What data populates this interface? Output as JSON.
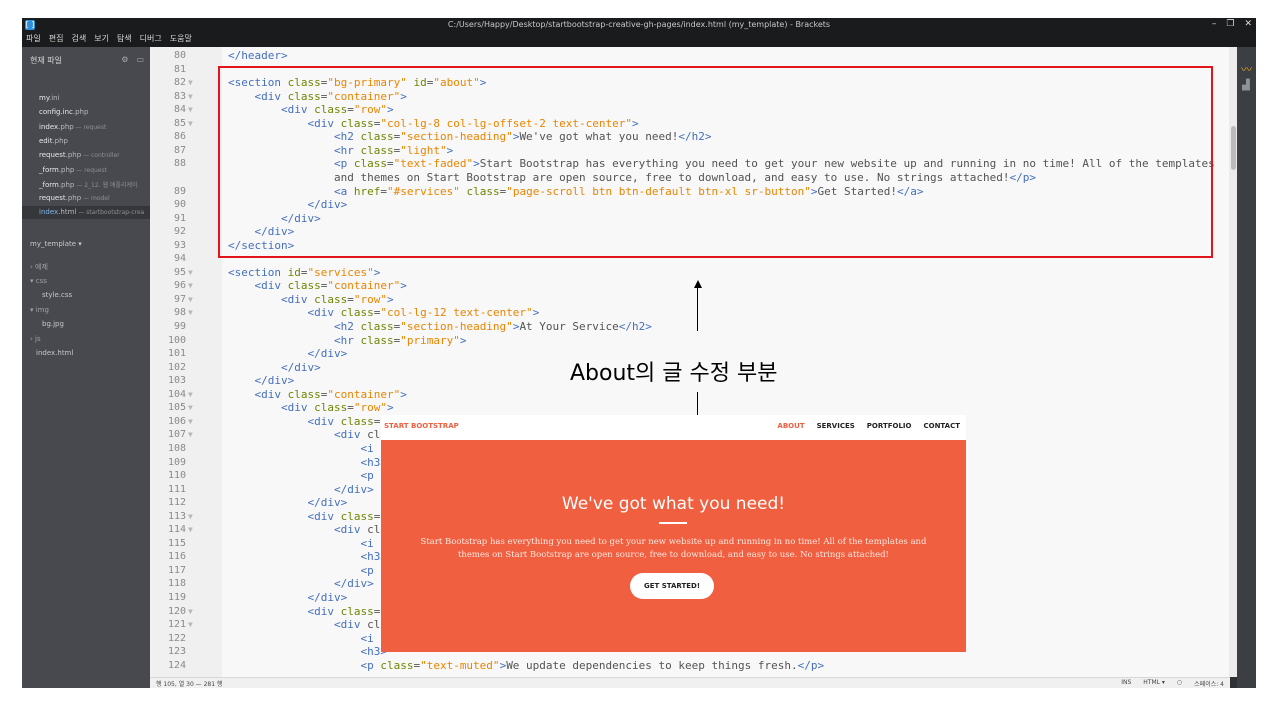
{
  "window": {
    "title": "C:/Users/Happy/Desktop/startbootstrap-creative-gh-pages/index.html (my_template) - Brackets",
    "controls": [
      "–",
      "❐",
      "✕"
    ]
  },
  "menu": [
    "파일",
    "편집",
    "검색",
    "보기",
    "탐색",
    "디버그",
    "도움말"
  ],
  "sidebar": {
    "header": "현재 파일",
    "working_files": [
      {
        "name": "my",
        "ext": ".ini",
        "sub": ""
      },
      {
        "name": "config.inc",
        "ext": ".php",
        "sub": ""
      },
      {
        "name": "index",
        "ext": ".php",
        "sub": " — request"
      },
      {
        "name": "edit",
        "ext": ".php",
        "sub": ""
      },
      {
        "name": "request",
        "ext": ".php",
        "sub": " — controller"
      },
      {
        "name": "_form",
        "ext": ".php",
        "sub": " — request"
      },
      {
        "name": "_form",
        "ext": ".php",
        "sub": " — 2_12. 웹 애플리케이"
      },
      {
        "name": "request",
        "ext": ".php",
        "sub": " — model"
      },
      {
        "name": "index",
        "ext": ".html",
        "sub": " — startbootstrap-crea"
      }
    ],
    "project": "my_template ▾",
    "tree": [
      {
        "label": "› 예제",
        "dim": true
      },
      {
        "label": "▾ css",
        "dim": true
      },
      {
        "label": "style.css",
        "dim": false
      },
      {
        "label": "▾ img",
        "dim": true
      },
      {
        "label": "bg.jpg",
        "dim": false
      },
      {
        "label": "› js",
        "dim": true
      },
      {
        "label": "index.html",
        "dim": false
      }
    ]
  },
  "code_lines": [
    {
      "n": "80",
      "fold": "",
      "code": "</header>"
    },
    {
      "n": "81",
      "fold": "",
      "code": ""
    },
    {
      "n": "82",
      "fold": "▼",
      "code": "<section class=\"bg-primary\" id=\"about\">"
    },
    {
      "n": "83",
      "fold": "▼",
      "code": "    <div class=\"container\">"
    },
    {
      "n": "84",
      "fold": "▼",
      "code": "        <div class=\"row\">"
    },
    {
      "n": "85",
      "fold": "▼",
      "code": "            <div class=\"col-lg-8 col-lg-offset-2 text-center\">"
    },
    {
      "n": "86",
      "fold": "",
      "code": "                <h2 class=\"section-heading\">We've got what you need!</h2>"
    },
    {
      "n": "87",
      "fold": "",
      "code": "                <hr class=\"light\">"
    },
    {
      "n": "88",
      "fold": "",
      "code": "                <p class=\"text-faded\">Start Bootstrap has everything you need to get your new website up and running in no time! All of the templates"
    },
    {
      "n": "",
      "fold": "",
      "code": "                and themes on Start Bootstrap are open source, free to download, and easy to use. No strings attached!</p>"
    },
    {
      "n": "89",
      "fold": "",
      "code": "                <a href=\"#services\" class=\"page-scroll btn btn-default btn-xl sr-button\">Get Started!</a>"
    },
    {
      "n": "90",
      "fold": "",
      "code": "            </div>"
    },
    {
      "n": "91",
      "fold": "",
      "code": "        </div>"
    },
    {
      "n": "92",
      "fold": "",
      "code": "    </div>"
    },
    {
      "n": "93",
      "fold": "",
      "code": "</section>"
    },
    {
      "n": "94",
      "fold": "",
      "code": ""
    },
    {
      "n": "95",
      "fold": "▼",
      "code": "<section id=\"services\">"
    },
    {
      "n": "96",
      "fold": "▼",
      "code": "    <div class=\"container\">"
    },
    {
      "n": "97",
      "fold": "▼",
      "code": "        <div class=\"row\">"
    },
    {
      "n": "98",
      "fold": "▼",
      "code": "            <div class=\"col-lg-12 text-center\">"
    },
    {
      "n": "99",
      "fold": "",
      "code": "                <h2 class=\"section-heading\">At Your Service</h2>"
    },
    {
      "n": "100",
      "fold": "",
      "code": "                <hr class=\"primary\">"
    },
    {
      "n": "101",
      "fold": "",
      "code": "            </div>"
    },
    {
      "n": "102",
      "fold": "",
      "code": "        </div>"
    },
    {
      "n": "103",
      "fold": "",
      "code": "    </div>"
    },
    {
      "n": "104",
      "fold": "▼",
      "code": "    <div class=\"container\">"
    },
    {
      "n": "105",
      "fold": "▼",
      "code": "        <div class=\"row\">"
    },
    {
      "n": "106",
      "fold": "▼",
      "code": "            <div class=\"col-lg-3 col-md-6 text-center\">"
    },
    {
      "n": "107",
      "fold": "▼",
      "code": "                <div cl"
    },
    {
      "n": "108",
      "fold": "",
      "code": "                    <i c"
    },
    {
      "n": "109",
      "fold": "",
      "code": "                    <h3>"
    },
    {
      "n": "110",
      "fold": "",
      "code": "                    <p c"
    },
    {
      "n": "111",
      "fold": "",
      "code": "                </div>"
    },
    {
      "n": "112",
      "fold": "",
      "code": "            </div>"
    },
    {
      "n": "113",
      "fold": "▼",
      "code": "            <div class=\""
    },
    {
      "n": "114",
      "fold": "▼",
      "code": "                <div cl"
    },
    {
      "n": "115",
      "fold": "",
      "code": "                    <i c"
    },
    {
      "n": "116",
      "fold": "",
      "code": "                    <h3>"
    },
    {
      "n": "117",
      "fold": "",
      "code": "                    <p c"
    },
    {
      "n": "118",
      "fold": "",
      "code": "                </div>"
    },
    {
      "n": "119",
      "fold": "",
      "code": "            </div>"
    },
    {
      "n": "120",
      "fold": "▼",
      "code": "            <div class=\""
    },
    {
      "n": "121",
      "fold": "▼",
      "code": "                <div cl"
    },
    {
      "n": "122",
      "fold": "",
      "code": "                    <i c"
    },
    {
      "n": "123",
      "fold": "",
      "code": "                    <h3>"
    },
    {
      "n": "124",
      "fold": "",
      "code": "                    <p class=\"text-muted\">We update dependencies to keep things fresh.</p>"
    }
  ],
  "statusbar": {
    "position": "행 105, 열 30 — 281 행",
    "ins": "INS",
    "language": "HTML ▾",
    "spaces": "스페이스: 4"
  },
  "annotation": "About의 글 수정 부분",
  "preview": {
    "brand": "START BOOTSTRAP",
    "nav": [
      "ABOUT",
      "SERVICES",
      "PORTFOLIO",
      "CONTACT"
    ],
    "heading": "We've got what you need!",
    "text": "Start Bootstrap has everything you need to get your new website up and running in no time! All of the templates and themes on Start Bootstrap are open source, free to download, and easy to use. No strings attached!",
    "button": "GET STARTED!"
  },
  "colors": {
    "highlight_border": "#e0161c",
    "preview_primary": "#f05f40",
    "tag": "#446fbd",
    "attr": "#6d8600",
    "string": "#e88501"
  }
}
